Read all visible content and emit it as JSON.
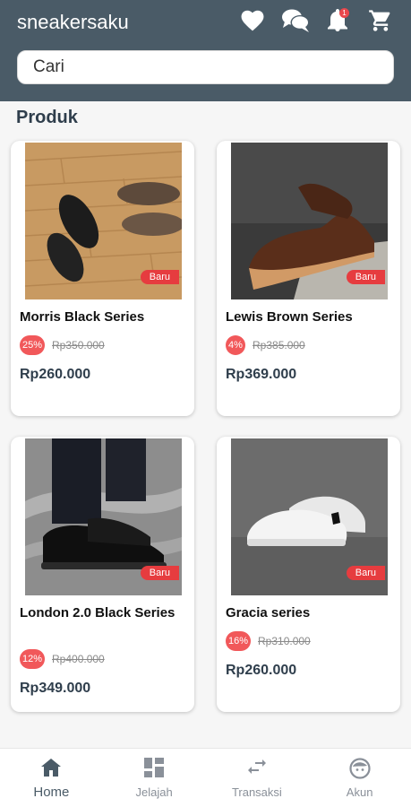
{
  "header": {
    "app_title": "sneakersaku",
    "notification_count": "1",
    "icons": [
      "heart-icon",
      "chat-icon",
      "bell-icon",
      "cart-icon"
    ],
    "background_color": "#4a5b67"
  },
  "search": {
    "placeholder": "Cari"
  },
  "section": {
    "title": "Produk"
  },
  "products": [
    {
      "name": "Morris Black Series",
      "badge": "Baru",
      "discount": "25%",
      "old_price": "Rp350.000",
      "price": "Rp260.000"
    },
    {
      "name": "Lewis Brown Series",
      "badge": "Baru",
      "discount": "4%",
      "old_price": "Rp385.000",
      "price": "Rp369.000"
    },
    {
      "name": "London 2.0 Black Series",
      "badge": "Baru",
      "discount": "12%",
      "old_price": "Rp400.000",
      "price": "Rp349.000"
    },
    {
      "name": "Gracia series",
      "badge": "Baru",
      "discount": "16%",
      "old_price": "Rp310.000",
      "price": "Rp260.000"
    }
  ],
  "bottom_nav": {
    "items": [
      {
        "label": "Home",
        "icon": "home-icon",
        "active": true
      },
      {
        "label": "Jelajah",
        "icon": "grid-icon",
        "active": false
      },
      {
        "label": "Transaksi",
        "icon": "swap-icon",
        "active": false
      },
      {
        "label": "Akun",
        "icon": "face-icon",
        "active": false
      }
    ]
  },
  "colors": {
    "accent": "#4a5b67",
    "discount": "#f1585a",
    "badge_new": "#e63c3f"
  }
}
